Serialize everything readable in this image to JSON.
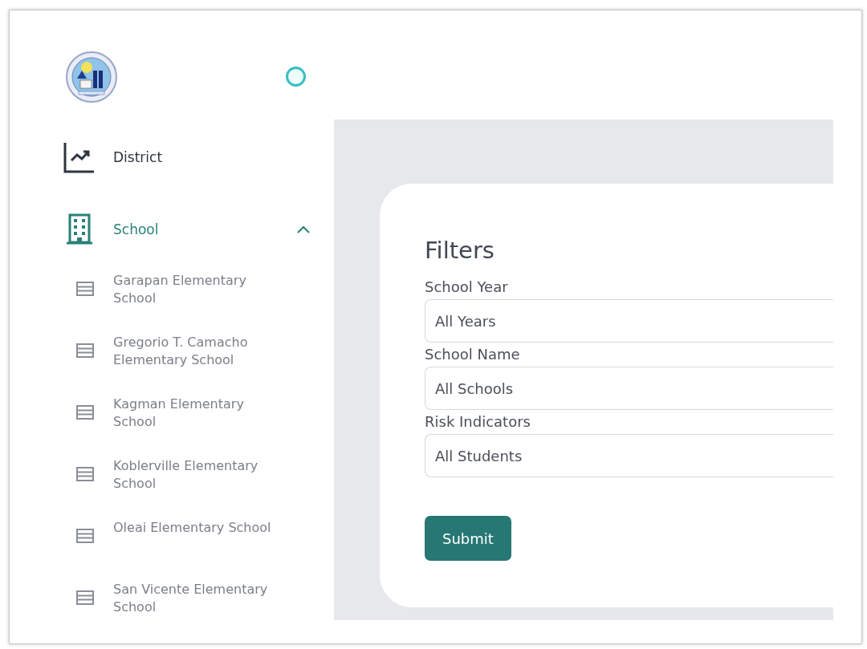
{
  "sidebar": {
    "items": [
      {
        "label": "District",
        "kind": "chart",
        "selected": false
      },
      {
        "label": "School",
        "kind": "building",
        "selected": true,
        "expanded": true,
        "children": [
          {
            "label": "Garapan Elementary School"
          },
          {
            "label": "Gregorio T. Camacho Elementary School"
          },
          {
            "label": "Kagman Elementary School"
          },
          {
            "label": "Koblerville Elementary School"
          },
          {
            "label": "Oleai Elementary School"
          },
          {
            "label": "San Vicente Elementary School"
          }
        ]
      }
    ]
  },
  "filters": {
    "title": "Filters",
    "fields": [
      {
        "label": "School Year",
        "value": "All Years"
      },
      {
        "label": "School Name",
        "value": "All Schools"
      },
      {
        "label": "Risk Indicators",
        "value": "All Students"
      }
    ],
    "submit": "Submit"
  }
}
